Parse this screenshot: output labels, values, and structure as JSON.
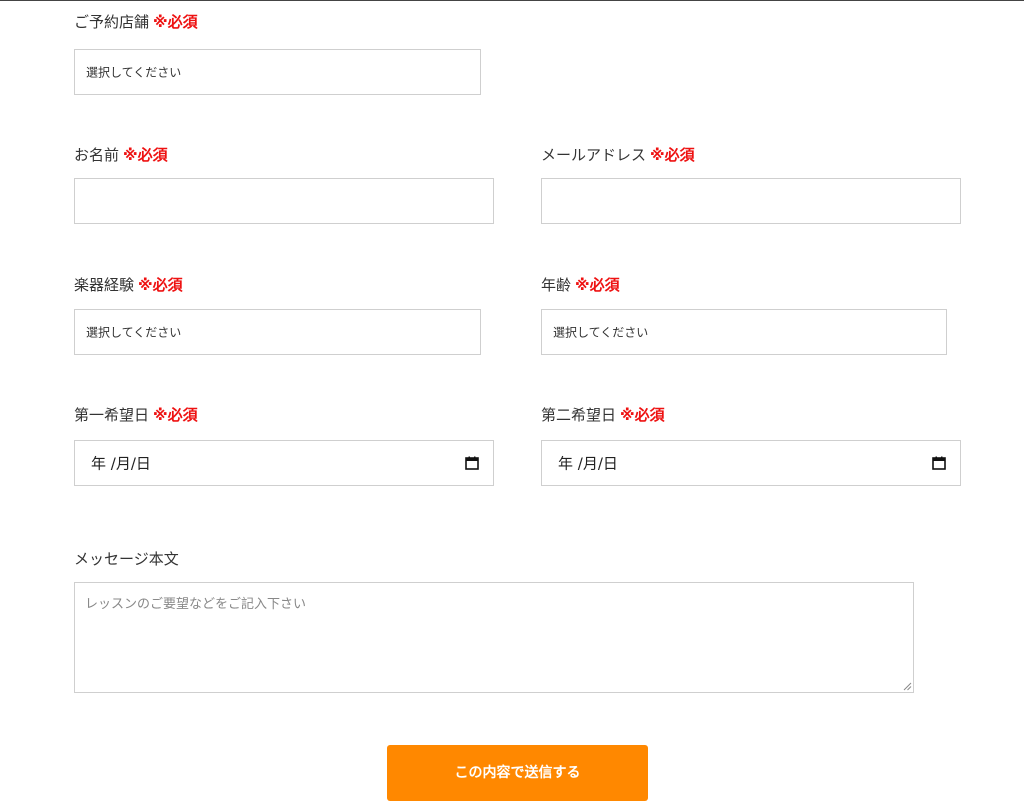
{
  "required_mark": "※必須",
  "store": {
    "label": "ご予約店舗",
    "select_value": "選択してください"
  },
  "name": {
    "label": "お名前",
    "value": ""
  },
  "email": {
    "label": "メールアドレス",
    "value": ""
  },
  "experience": {
    "label": "楽器経験",
    "select_value": "選択してください"
  },
  "age": {
    "label": "年齢",
    "select_value": "選択してください"
  },
  "first_date": {
    "label": "第一希望日",
    "value_text": "年 /月/日",
    "icon": "calendar-icon"
  },
  "second_date": {
    "label": "第二希望日",
    "value_text": "年 /月/日",
    "icon": "calendar-icon"
  },
  "message": {
    "label": "メッセージ本文",
    "placeholder": "レッスンのご要望などをご記入下さい"
  },
  "submit": {
    "label": "この内容で送信する"
  },
  "colors": {
    "required": "#ee1111",
    "button": "#ff8800",
    "border": "#cfcfcf"
  }
}
